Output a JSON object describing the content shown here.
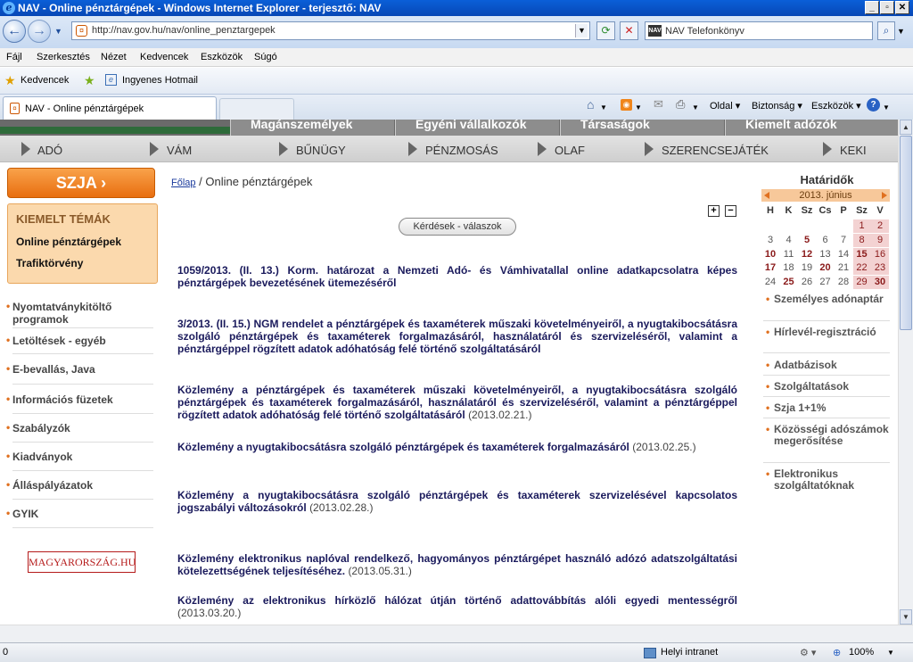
{
  "window": {
    "title": "NAV - Online pénztárgépek - Windows Internet Explorer - terjesztő: NAV"
  },
  "browser": {
    "address": "http://nav.gov.hu/nav/online_penztargepek",
    "search_placeholder": "NAV Telefonkönyv",
    "menu": [
      "Fájl",
      "Szerkesztés",
      "Nézet",
      "Kedvencek",
      "Eszközök",
      "Súgó"
    ],
    "favorites_label": "Kedvencek",
    "favorites_item": "Ingyenes Hotmail",
    "tab_title": "NAV - Online pénztárgépek",
    "commands": {
      "page": "Oldal",
      "security": "Biztonság",
      "tools": "Eszközök"
    },
    "status": {
      "left": "0",
      "zone": "Helyi intranet",
      "zoom": "100%"
    }
  },
  "site": {
    "top_tabs": [
      "Magánszemélyek",
      "Egyéni vállalkozók",
      "Társaságok",
      "Kiemelt adózók"
    ],
    "main_nav": [
      "ADÓ",
      "VÁM",
      "BŰNÜGY",
      "PÉNZMOSÁS",
      "OLAF",
      "SZERENCSEJÁTÉK",
      "KEKI"
    ],
    "szja_button": "SZJA  ›",
    "kiemelt": {
      "heading": "KIEMELT TÉMÁK",
      "links": [
        "Online pénztárgépek",
        "Trafiktörvény"
      ]
    },
    "left_nav": [
      "Nyomtatványkitöltő programok",
      "Letöltések - egyéb",
      "E-bevallás, Java",
      "Információs füzetek",
      "Szabályzók",
      "Kiadványok",
      "Álláspályázatok",
      "GYIK"
    ],
    "magyarorszag": "MAGYARORSZÁG.HU",
    "breadcrumb": {
      "home": "Főlap",
      "sep": "/",
      "current": "Online pénztárgépek"
    },
    "plus": "+",
    "minus": "−",
    "faq_button": "Kérdések - válaszok",
    "items": [
      {
        "title": "1059/2013. (II. 13.) Korm. határozat a Nemzeti Adó- és Vámhivatallal online adatkapcsolatra képes pénztárgépek bevezetésének ütemezéséről",
        "date": ""
      },
      {
        "title": "3/2013. (II. 15.) NGM rendelet a pénztárgépek és taxaméterek műszaki követelményeiről, a nyugtakibocsátásra szolgáló pénztárgépek és taxaméterek forgalmazásáról, használatáról és szervizeléséről, valamint a pénztárgéppel rögzített adatok adóhatóság felé történő szolgáltatásáról",
        "date": ""
      },
      {
        "title": "Közlemény a pénztárgépek és taxaméterek műszaki követelményeiről, a nyugtakibocsátásra szolgáló pénztárgépek és taxaméterek forgalmazásáról, használatáról és szervizeléséről, valamint a pénztárgéppel rögzített adatok adóhatóság felé történő szolgáltatásáról",
        "date": "(2013.02.21.)"
      },
      {
        "title": "Közlemény a nyugtakibocsátásra szolgáló pénztárgépek és taxaméterek forgalmazásáról",
        "date": "(2013.02.25.)"
      },
      {
        "title": "Közlemény a nyugtakibocsátásra szolgáló pénztárgépek és taxaméterek szervizelésével kapcsolatos jogszabályi változásokról",
        "date": "(2013.02.28.)"
      },
      {
        "title": "Közlemény elektronikus naplóval rendelkező, hagyományos pénztárgépet használó adózó adatszolgáltatási kötelezettségének teljesítéséhez.",
        "date": "(2013.05.31.)"
      },
      {
        "title": "Közlemény az elektronikus hírközlő hálózat útján történő adattovábbítás alóli egyedi mentességről",
        "date": "(2013.03.20.)"
      }
    ],
    "calendar": {
      "title": "Határidők",
      "month": "2013. június",
      "weekdays": [
        "H",
        "K",
        "Sz",
        "Cs",
        "P",
        "Sz",
        "V"
      ],
      "rows": [
        [
          "",
          "",
          "",
          "",
          "",
          "1",
          "2"
        ],
        [
          "3",
          "4",
          "5",
          "6",
          "7",
          "8",
          "9"
        ],
        [
          "10",
          "11",
          "12",
          "13",
          "14",
          "15",
          "16"
        ],
        [
          "17",
          "18",
          "19",
          "20",
          "21",
          "22",
          "23"
        ],
        [
          "24",
          "25",
          "26",
          "27",
          "28",
          "29",
          "30"
        ]
      ],
      "bold_days": [
        "5",
        "10",
        "12",
        "15",
        "17",
        "20",
        "25",
        "30"
      ]
    },
    "right_nav": [
      "Személyes adónaptár",
      "Hírlevél-regisztráció",
      "Adatbázisok",
      "Szolgáltatások",
      "Szja 1+1%",
      "Közösségi adószámok megerősítése",
      "Elektronikus szolgáltatóknak"
    ]
  }
}
